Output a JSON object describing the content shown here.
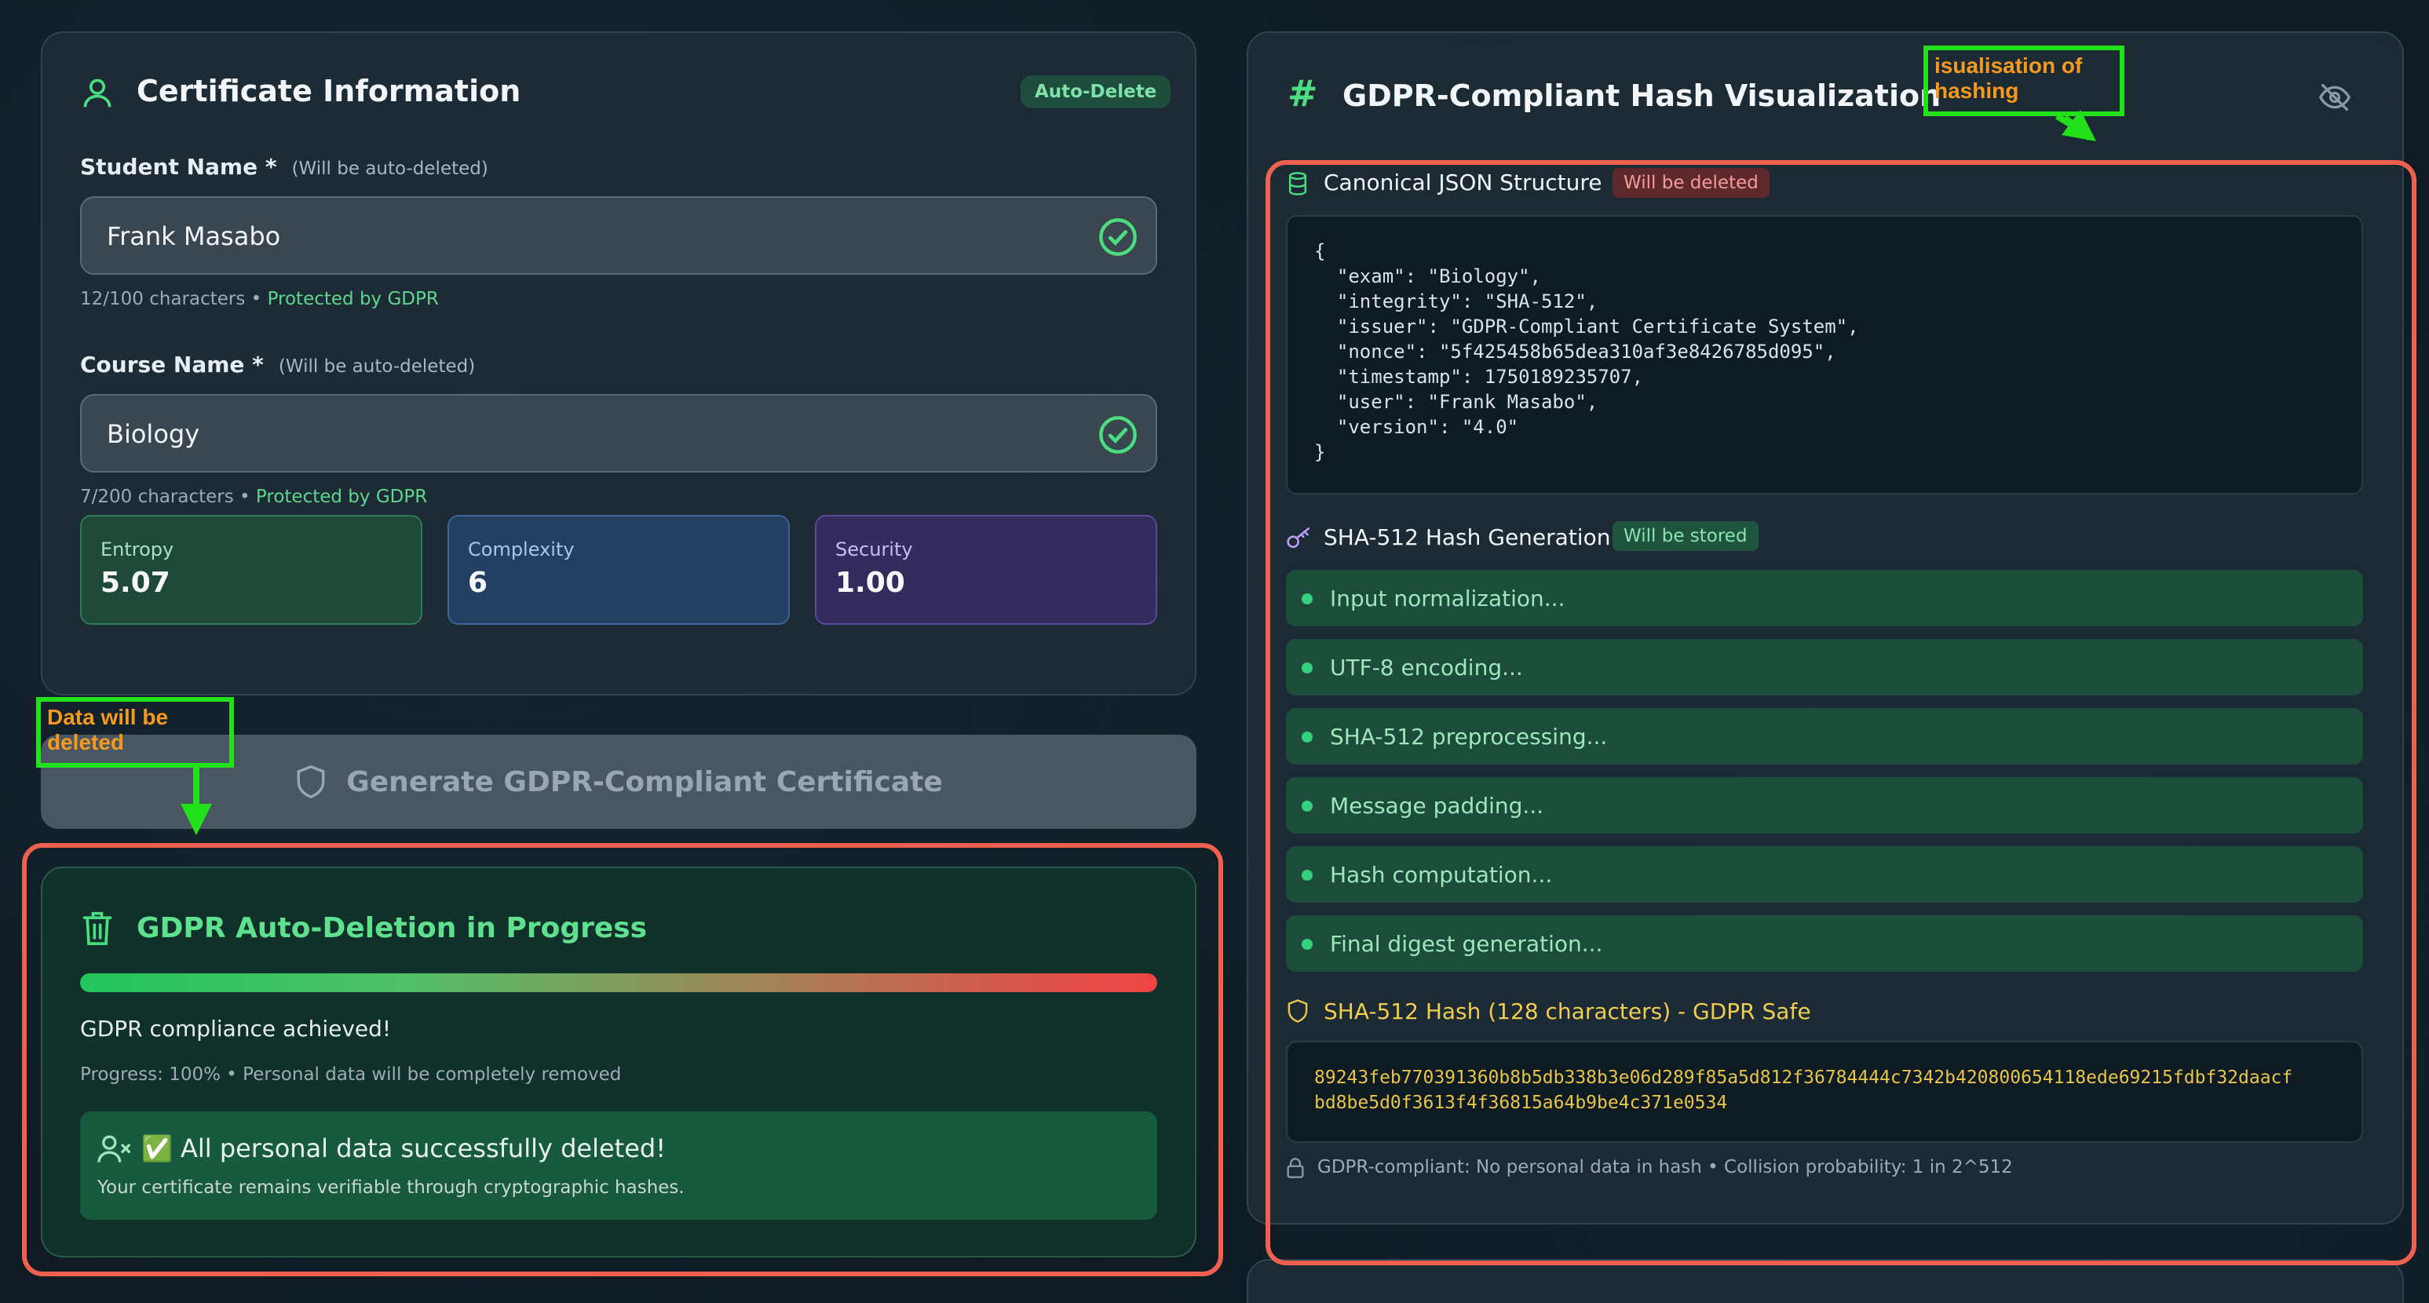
{
  "certificate": {
    "title": "Certificate Information",
    "auto_delete_badge": "Auto-Delete",
    "student": {
      "label": "Student Name *",
      "note": "(Will be auto-deleted)",
      "value": "Frank Masabo",
      "count": "12/100 characters",
      "protected": "Protected by GDPR"
    },
    "course": {
      "label": "Course Name *",
      "note": "(Will be auto-deleted)",
      "value": "Biology",
      "count": "7/200 characters",
      "protected": "Protected by GDPR"
    },
    "metrics": {
      "entropy": {
        "label": "Entropy",
        "value": "5.07"
      },
      "complexity": {
        "label": "Complexity",
        "value": "6"
      },
      "security": {
        "label": "Security",
        "value": "1.00"
      }
    }
  },
  "generate_button": "Generate GDPR-Compliant Certificate",
  "deletion": {
    "title": "GDPR Auto-Deletion in Progress",
    "progress": 1.0,
    "status": "GDPR compliance achieved!",
    "details": "Progress: 100% • Personal data will be completely removed",
    "success_title": "✅ All personal data successfully deleted!",
    "success_sub": "Your certificate remains verifiable through cryptographic hashes."
  },
  "hash_viz": {
    "title": "GDPR-Compliant Hash Visualization",
    "json_section": {
      "title": "Canonical JSON Structure",
      "badge": "Will be deleted"
    },
    "json_lines": [
      "{",
      "  \"exam\": \"Biology\",",
      "  \"integrity\": \"SHA-512\",",
      "  \"issuer\": \"GDPR-Compliant Certificate System\",",
      "  \"nonce\": \"5f425458b65dea310af3e8426785d095\",",
      "  \"timestamp\": 1750189235707,",
      "  \"user\": \"Frank Masabo\",",
      "  \"version\": \"4.0\"",
      "}"
    ],
    "hash_section": {
      "title": "SHA-512 Hash Generation",
      "badge": "Will be stored"
    },
    "steps": [
      "Input normalization...",
      "UTF-8 encoding...",
      "SHA-512 preprocessing...",
      "Message padding...",
      "Hash computation...",
      "Final digest generation..."
    ],
    "result_title": "SHA-512 Hash (128 characters) - GDPR Safe",
    "hash_lines": [
      "89243feb770391360b8b5db338b3e06d289f85a5d812f36784444c7342b420800654118ede69215fdbf32daacf",
      "bd8be5d0f3613f4f36815a64b9be4c371e0534"
    ],
    "footer": "GDPR-compliant: No personal data in hash • Collision probability: 1 in 2^512"
  },
  "annotations": {
    "data_deleted": "Data will be deleted",
    "visualisation": "isualisation of hashing"
  },
  "colors": {
    "accent_green": "#22c55e",
    "accent_red": "#ef4444",
    "hash_yellow": "#e8c44a",
    "annotation_green": "#22e01a",
    "annotation_red": "#f0604e",
    "annotation_text": "#f59a1e"
  }
}
